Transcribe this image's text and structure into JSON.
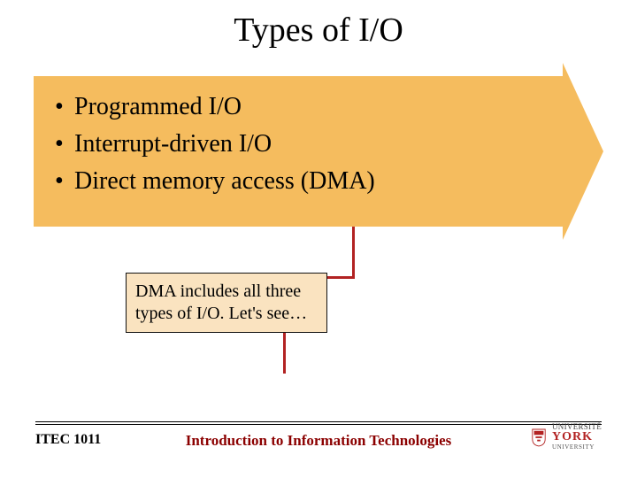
{
  "title": "Types of I/O",
  "bullets": [
    "Programmed I/O",
    "Interrupt-driven I/O",
    "Direct memory access (DMA)"
  ],
  "note": "DMA includes all three types of I/O. Let's see…",
  "footer": {
    "course_code": "ITEC 1011",
    "course_title": "Introduction to Information Technologies",
    "logo": {
      "line1": "UNIVERSITÉ",
      "line2": "YORK",
      "line3": "UNIVERSITY"
    }
  }
}
